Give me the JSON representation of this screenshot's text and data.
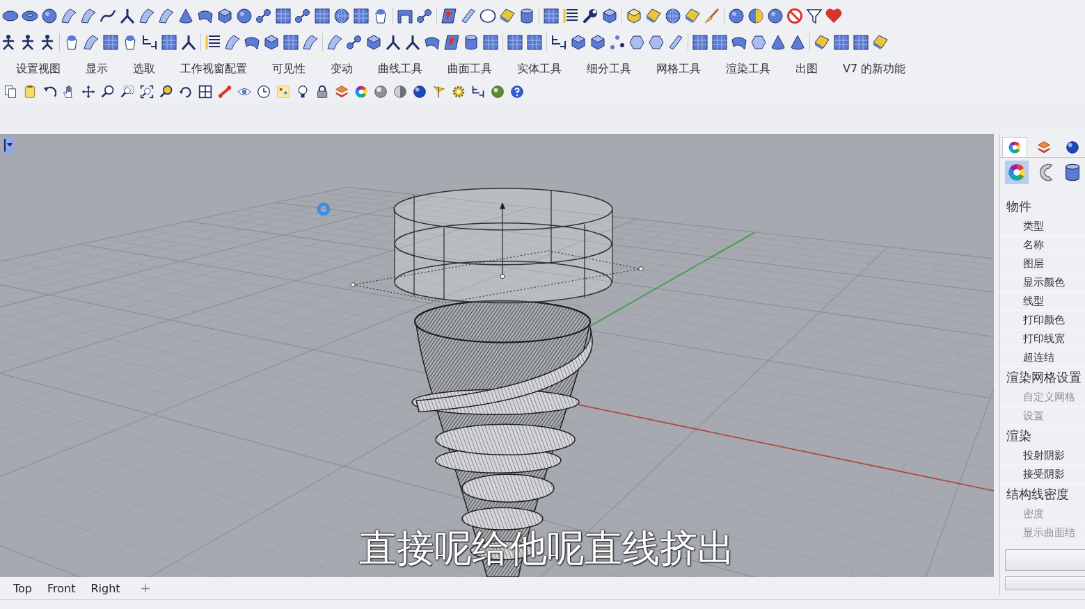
{
  "menu_tabs": [
    {
      "label": "设置视图",
      "selected": false
    },
    {
      "label": "显示",
      "selected": false
    },
    {
      "label": "选取",
      "selected": false
    },
    {
      "label": "工作视窗配置",
      "selected": false
    },
    {
      "label": "可见性",
      "selected": false
    },
    {
      "label": "变动",
      "selected": false
    },
    {
      "label": "曲线工具",
      "selected": false
    },
    {
      "label": "曲面工具",
      "selected": false
    },
    {
      "label": "实体工具",
      "selected": false
    },
    {
      "label": "细分工具",
      "selected": false
    },
    {
      "label": "网格工具",
      "selected": false
    },
    {
      "label": "渲染工具",
      "selected": false
    },
    {
      "label": "出图",
      "selected": false
    },
    {
      "label": "V7 的新功能",
      "selected": false
    }
  ],
  "viewport": {
    "subtitle": "直接呢给他呢直线挤出"
  },
  "viewport_tabs": {
    "tabs": [
      {
        "label": "Top",
        "selected": false
      },
      {
        "label": "Front",
        "selected": false
      },
      {
        "label": "Right",
        "selected": false
      }
    ],
    "add_symbol": "+"
  },
  "properties_panel": {
    "tabs": [
      {
        "selected": true
      },
      {
        "selected": false
      },
      {
        "selected": false
      }
    ],
    "pages": [
      {
        "selected": true
      },
      {
        "selected": false
      },
      {
        "selected": false
      }
    ],
    "sections": [
      {
        "title": "物件",
        "items": [
          {
            "label": "类型",
            "disabled": false
          },
          {
            "label": "名称",
            "disabled": false
          },
          {
            "label": "图层",
            "disabled": false
          },
          {
            "label": "显示颜色",
            "disabled": false
          },
          {
            "label": "线型",
            "disabled": false
          },
          {
            "label": "打印颜色",
            "disabled": false
          },
          {
            "label": "打印线宽",
            "disabled": false
          },
          {
            "label": "超连结",
            "disabled": false
          }
        ]
      },
      {
        "title": "渲染网格设置",
        "items": [
          {
            "label": "自定义网格",
            "disabled": true
          },
          {
            "label": "设置",
            "disabled": true
          }
        ]
      },
      {
        "title": "渲染",
        "items": [
          {
            "label": "投射阴影",
            "disabled": false
          },
          {
            "label": "接受阴影",
            "disabled": false
          }
        ]
      },
      {
        "title": "结构线密度",
        "items": [
          {
            "label": "密度",
            "disabled": true
          },
          {
            "label": "显示曲面结",
            "disabled": true
          }
        ]
      }
    ]
  }
}
